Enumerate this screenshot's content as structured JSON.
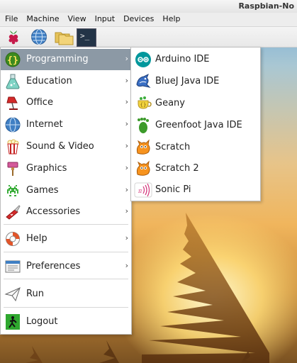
{
  "window": {
    "title": "Raspbian-No"
  },
  "menubar": {
    "items": [
      "File",
      "Machine",
      "View",
      "Input",
      "Devices",
      "Help"
    ]
  },
  "taskbar": {
    "buttons": [
      {
        "icon": "raspberry-icon"
      },
      {
        "icon": "globe-icon"
      },
      {
        "icon": "folders-icon"
      },
      {
        "icon": "terminal-icon",
        "text": ">_"
      }
    ]
  },
  "main_menu": {
    "items": [
      {
        "label": "Programming",
        "icon": "braces-icon",
        "has_submenu": true,
        "active": true
      },
      {
        "label": "Education",
        "icon": "flask-icon",
        "has_submenu": true
      },
      {
        "label": "Office",
        "icon": "lamp-icon",
        "has_submenu": true
      },
      {
        "label": "Internet",
        "icon": "globe-icon",
        "has_submenu": true
      },
      {
        "label": "Sound & Video",
        "icon": "popcorn-icon",
        "has_submenu": true
      },
      {
        "label": "Graphics",
        "icon": "paint-icon",
        "has_submenu": true
      },
      {
        "label": "Games",
        "icon": "invader-icon",
        "has_submenu": true
      },
      {
        "label": "Accessories",
        "icon": "knife-icon",
        "has_submenu": true
      },
      {
        "label": "Help",
        "icon": "lifebuoy-icon",
        "has_submenu": true
      },
      {
        "label": "Preferences",
        "icon": "preferences-icon",
        "has_submenu": true
      },
      {
        "label": "Run",
        "icon": "paper-plane-icon",
        "has_submenu": false
      },
      {
        "label": "Logout",
        "icon": "exit-icon",
        "has_submenu": false
      }
    ],
    "arrow": "›"
  },
  "submenu": {
    "items": [
      {
        "label": "Arduino IDE",
        "icon": "arduino-icon"
      },
      {
        "label": "BlueJ Java IDE",
        "icon": "bluej-icon"
      },
      {
        "label": "Geany",
        "icon": "geany-icon"
      },
      {
        "label": "Greenfoot Java IDE",
        "icon": "greenfoot-icon"
      },
      {
        "label": "Scratch",
        "icon": "scratch-icon"
      },
      {
        "label": "Scratch 2",
        "icon": "scratch-icon"
      },
      {
        "label": "Sonic Pi",
        "icon": "sonic-pi-icon"
      }
    ]
  },
  "colors": {
    "menu_highlight": "#8c99a5",
    "arduino": "#00979c"
  }
}
